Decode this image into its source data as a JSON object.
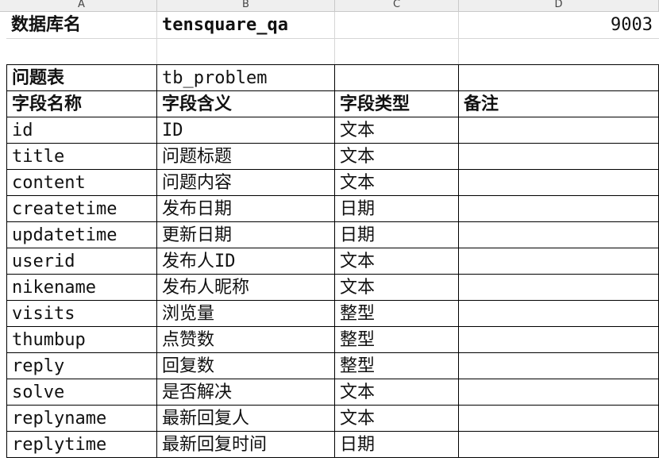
{
  "columns": [
    "A",
    "B",
    "C",
    "D"
  ],
  "meta": {
    "db_label": "数据库名",
    "db_name": "tensquare_qa",
    "port": "9003"
  },
  "table": {
    "label": "问题表",
    "name": "tb_problem",
    "headers": [
      "字段名称",
      "字段含义",
      "字段类型",
      "备注"
    ],
    "rows": [
      {
        "field": "id",
        "meaning": "ID",
        "type": "文本",
        "note": ""
      },
      {
        "field": "title",
        "meaning": "问题标题",
        "type": "文本",
        "note": ""
      },
      {
        "field": "content",
        "meaning": "问题内容",
        "type": "文本",
        "note": ""
      },
      {
        "field": "createtime",
        "meaning": "发布日期",
        "type": "日期",
        "note": ""
      },
      {
        "field": "updatetime",
        "meaning": "更新日期",
        "type": "日期",
        "note": ""
      },
      {
        "field": "userid",
        "meaning": "发布人ID",
        "type": "文本",
        "note": ""
      },
      {
        "field": "nikename",
        "meaning": "发布人昵称",
        "type": "文本",
        "note": ""
      },
      {
        "field": "visits",
        "meaning": "浏览量",
        "type": "整型",
        "note": ""
      },
      {
        "field": "thumbup",
        "meaning": "点赞数",
        "type": "整型",
        "note": ""
      },
      {
        "field": "reply",
        "meaning": "回复数",
        "type": "整型",
        "note": ""
      },
      {
        "field": "solve",
        "meaning": "是否解决",
        "type": "文本",
        "note": ""
      },
      {
        "field": "replyname",
        "meaning": "最新回复人",
        "type": "文本",
        "note": ""
      },
      {
        "field": "replytime",
        "meaning": "最新回复时间",
        "type": "日期",
        "note": ""
      }
    ]
  }
}
